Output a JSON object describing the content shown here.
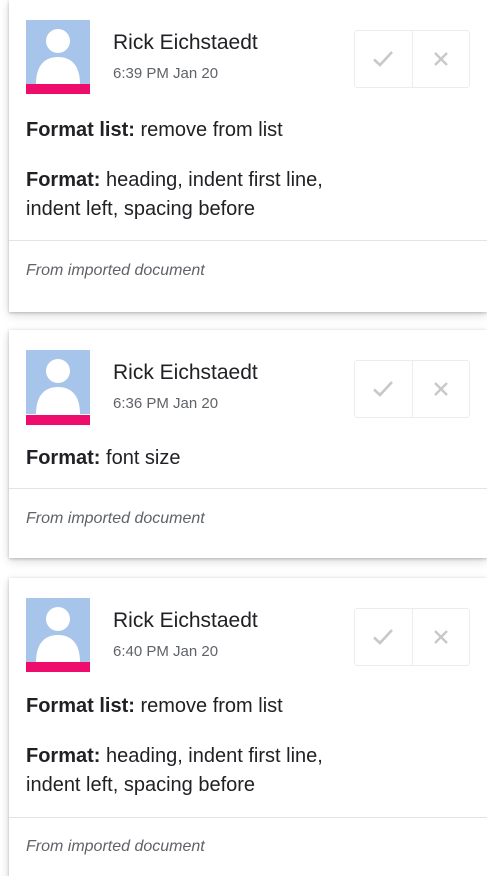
{
  "suggestions": [
    {
      "author": "Rick Eichstaedt",
      "timestamp": "6:39 PM Jan 20",
      "line1_label": "Format list:",
      "line1_value": " remove from list",
      "line2_label": "Format:",
      "line2_value": " heading, indent first line,",
      "line3_value": "indent left, spacing before",
      "footer": "From imported document"
    },
    {
      "author": "Rick Eichstaedt",
      "timestamp": "6:36 PM Jan 20",
      "line1_label": "Format:",
      "line1_value": " font size",
      "footer": "From imported document"
    },
    {
      "author": "Rick Eichstaedt",
      "timestamp": "6:40 PM Jan 20",
      "line1_label": "Format list:",
      "line1_value": " remove from list",
      "line2_label": "Format:",
      "line2_value": " heading, indent first line,",
      "line3_value": "indent left, spacing before",
      "footer": "From imported document"
    }
  ],
  "icons": {
    "accept": "checkmark-icon",
    "reject": "close-icon",
    "avatar": "default-avatar-icon"
  },
  "colors": {
    "avatar_bg": "#a7c4ea",
    "avatar_silhouette": "#ffffff",
    "author_accent": "#ee0d6c",
    "icon_gray": "#c8c8c8"
  }
}
